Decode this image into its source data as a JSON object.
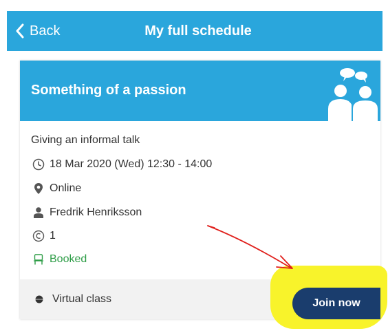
{
  "header": {
    "back_label": "Back",
    "title": "My full schedule"
  },
  "card": {
    "title": "Something of a passion",
    "header_icon": "people-chat-icon",
    "session_type": "Giving an informal talk",
    "details": {
      "time": "18 Mar 2020 (Wed) 12:30 - 14:00",
      "location": "Online",
      "teacher": "Fredrik Henriksson",
      "credits": "1",
      "status": "Booked"
    },
    "footer": {
      "class_type": "Virtual class",
      "join_label": "Join now"
    }
  },
  "colors": {
    "header_blue": "#2aa6dc",
    "join_button": "#1a3d6d",
    "status_green": "#2e9d47",
    "highlight_yellow": "#f8f32b",
    "annotation_arrow": "#e0201c"
  }
}
